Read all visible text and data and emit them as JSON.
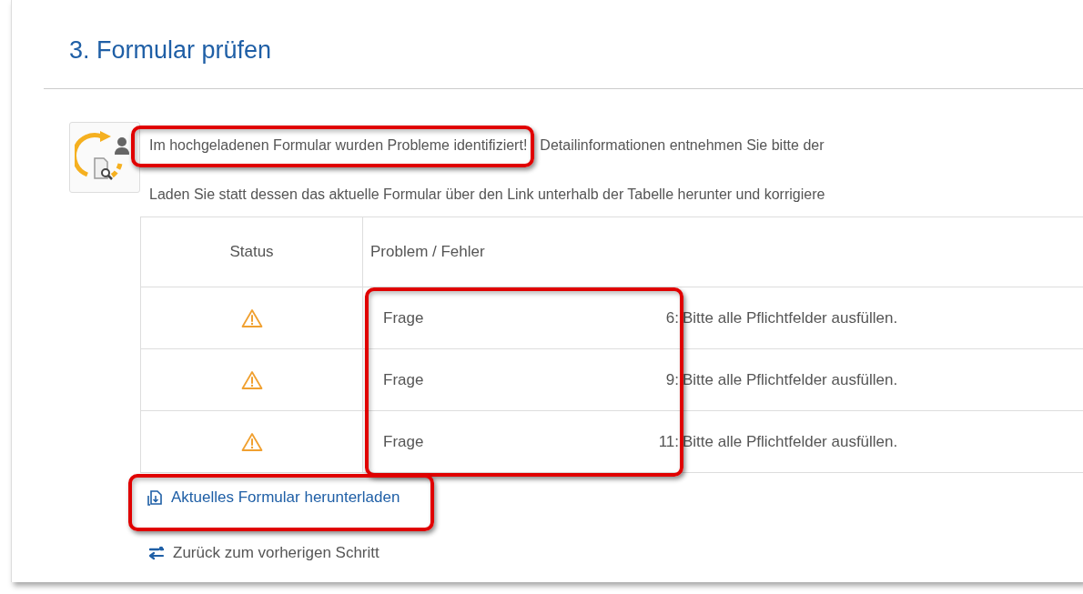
{
  "section": {
    "title": "3. Formular prüfen"
  },
  "messages": [
    {
      "parts": [
        {
          "text": "Im hochgeladenen Formular wurden Probleme identifiziert!",
          "highlighted": true
        },
        {
          "text": "Detailinformationen entnehmen Sie bitte der",
          "highlighted": false
        }
      ]
    },
    {
      "parts": [
        {
          "text": "Laden Sie statt dessen das aktuelle Formular über den Link unterhalb der Tabelle herunter und korrigiere",
          "highlighted": false
        }
      ]
    }
  ],
  "table": {
    "columns": [
      "Status",
      "Problem / Fehler"
    ],
    "problems_highlighted": true,
    "rows": [
      {
        "label": "Frage",
        "number": "6:",
        "message": "Bitte alle Pflichtfelder ausfüllen."
      },
      {
        "label": "Frage",
        "number": "9:",
        "message": "Bitte alle Pflichtfelder ausfüllen."
      },
      {
        "label": "Frage",
        "number": "11:",
        "message": "Bitte alle Pflichtfelder ausfüllen."
      }
    ]
  },
  "links": [
    {
      "kind": "download",
      "text": "Aktuelles Formular herunterladen",
      "highlighted": true
    },
    {
      "kind": "back",
      "text": "Zurück zum vorherigen Schritt",
      "highlighted": false
    }
  ]
}
